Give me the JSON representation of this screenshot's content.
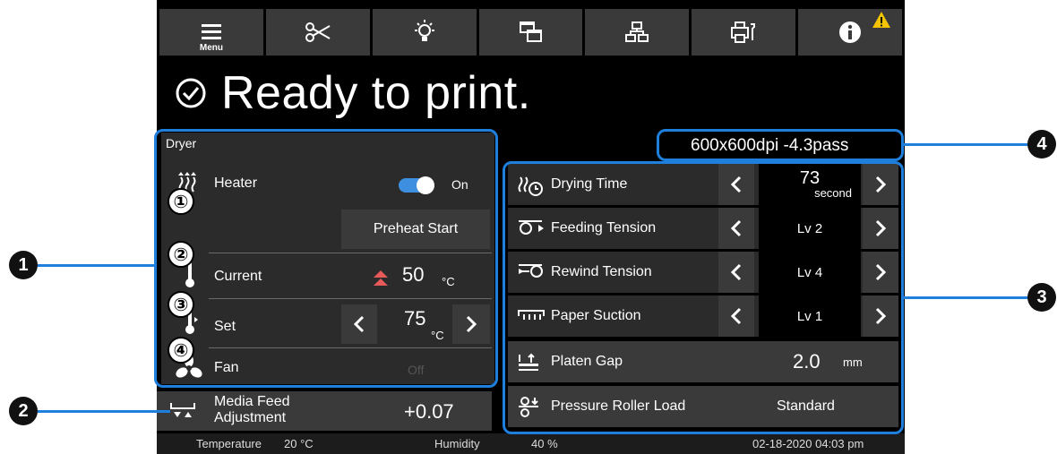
{
  "toolbar": {
    "items": [
      {
        "icon": "menu-icon",
        "caption": "Menu"
      },
      {
        "icon": "scissors-icon"
      },
      {
        "icon": "lamp-icon"
      },
      {
        "icon": "windows-icon"
      },
      {
        "icon": "network-icon"
      },
      {
        "icon": "printer-maintenance-icon"
      },
      {
        "icon": "info-icon",
        "warning": "warning-icon"
      }
    ]
  },
  "status": {
    "text": "Ready to print."
  },
  "print_mode": "600x600dpi -4.3pass",
  "dryer": {
    "title": "Dryer",
    "heater": {
      "label": "Heater",
      "state": "On",
      "preheat_button": "Preheat Start",
      "number": "①"
    },
    "current": {
      "label": "Current",
      "value": "50",
      "unit": "°C",
      "number": "②"
    },
    "set": {
      "label": "Set",
      "value": "75",
      "unit": "°C",
      "number": "③"
    },
    "fan": {
      "label": "Fan",
      "state": "Off",
      "number": "④"
    }
  },
  "media_feed": {
    "label_line1": "Media Feed",
    "label_line2": "Adjustment",
    "value": "+0.07"
  },
  "settings": {
    "drying_time": {
      "label": "Drying Time",
      "value": "73",
      "unit": "second"
    },
    "feeding_tension": {
      "label": "Feeding Tension",
      "value": "Lv 2"
    },
    "rewind_tension": {
      "label": "Rewind Tension",
      "value": "Lv 4"
    },
    "paper_suction": {
      "label": "Paper Suction",
      "value": "Lv 1"
    },
    "platen_gap": {
      "label": "Platen Gap",
      "value": "2.0",
      "unit": "mm"
    },
    "pressure_roller": {
      "label": "Pressure Roller Load",
      "value": "Standard"
    }
  },
  "footer": {
    "temperature_label": "Temperature",
    "temperature_value": "20 °C",
    "humidity_label": "Humidity",
    "humidity_value": "40 %",
    "datetime": "02-18-2020 04:03 pm"
  },
  "callouts": [
    "1",
    "2",
    "3",
    "4"
  ],
  "colors": {
    "highlight": "#1e7fdc",
    "toggle": "#3f8fe0",
    "warning": "#f5c400"
  }
}
